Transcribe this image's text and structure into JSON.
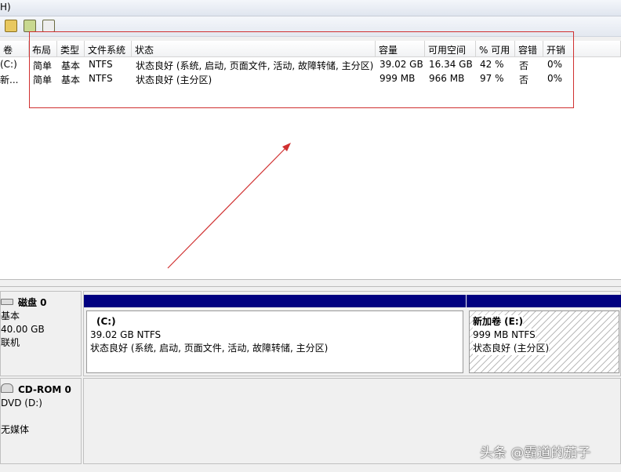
{
  "menu": {
    "partial_item": "H)"
  },
  "toolbar": {
    "icons": [
      "open-folder-icon",
      "refresh-icon",
      "properties-icon"
    ]
  },
  "volume_list": {
    "columns": [
      "卷",
      "布局",
      "类型",
      "文件系统",
      "状态",
      "容量",
      "可用空间",
      "% 可用",
      "容错",
      "开销"
    ],
    "rows": [
      [
        "(C:)",
        "简单",
        "基本",
        "NTFS",
        "状态良好 (系统, 启动, 页面文件, 活动, 故障转储, 主分区)",
        "39.02 GB",
        "16.34 GB",
        "42 %",
        "否",
        "0%"
      ],
      [
        "新...",
        "简单",
        "基本",
        "NTFS",
        "状态良好 (主分区)",
        "999 MB",
        "966 MB",
        "97 %",
        "否",
        "0%"
      ]
    ]
  },
  "disks": [
    {
      "name": "磁盘 0",
      "type": "基本",
      "size": "40.00 GB",
      "status": "联机",
      "partitions": [
        {
          "name": "(C:)",
          "size_fs": "39.02 GB NTFS",
          "status": "状态良好 (系统, 启动, 页面文件, 活动, 故障转储, 主分区)"
        },
        {
          "name": "新加卷  (E:)",
          "size_fs": "999 MB NTFS",
          "status": "状态良好 (主分区)"
        }
      ]
    },
    {
      "name": "CD-ROM 0",
      "type": "DVD (D:)",
      "status": "无媒体"
    }
  ],
  "watermark": "头条 @霸道的茄子",
  "colors": {
    "partition_bar": "#000080",
    "annotation": "#d03030"
  }
}
